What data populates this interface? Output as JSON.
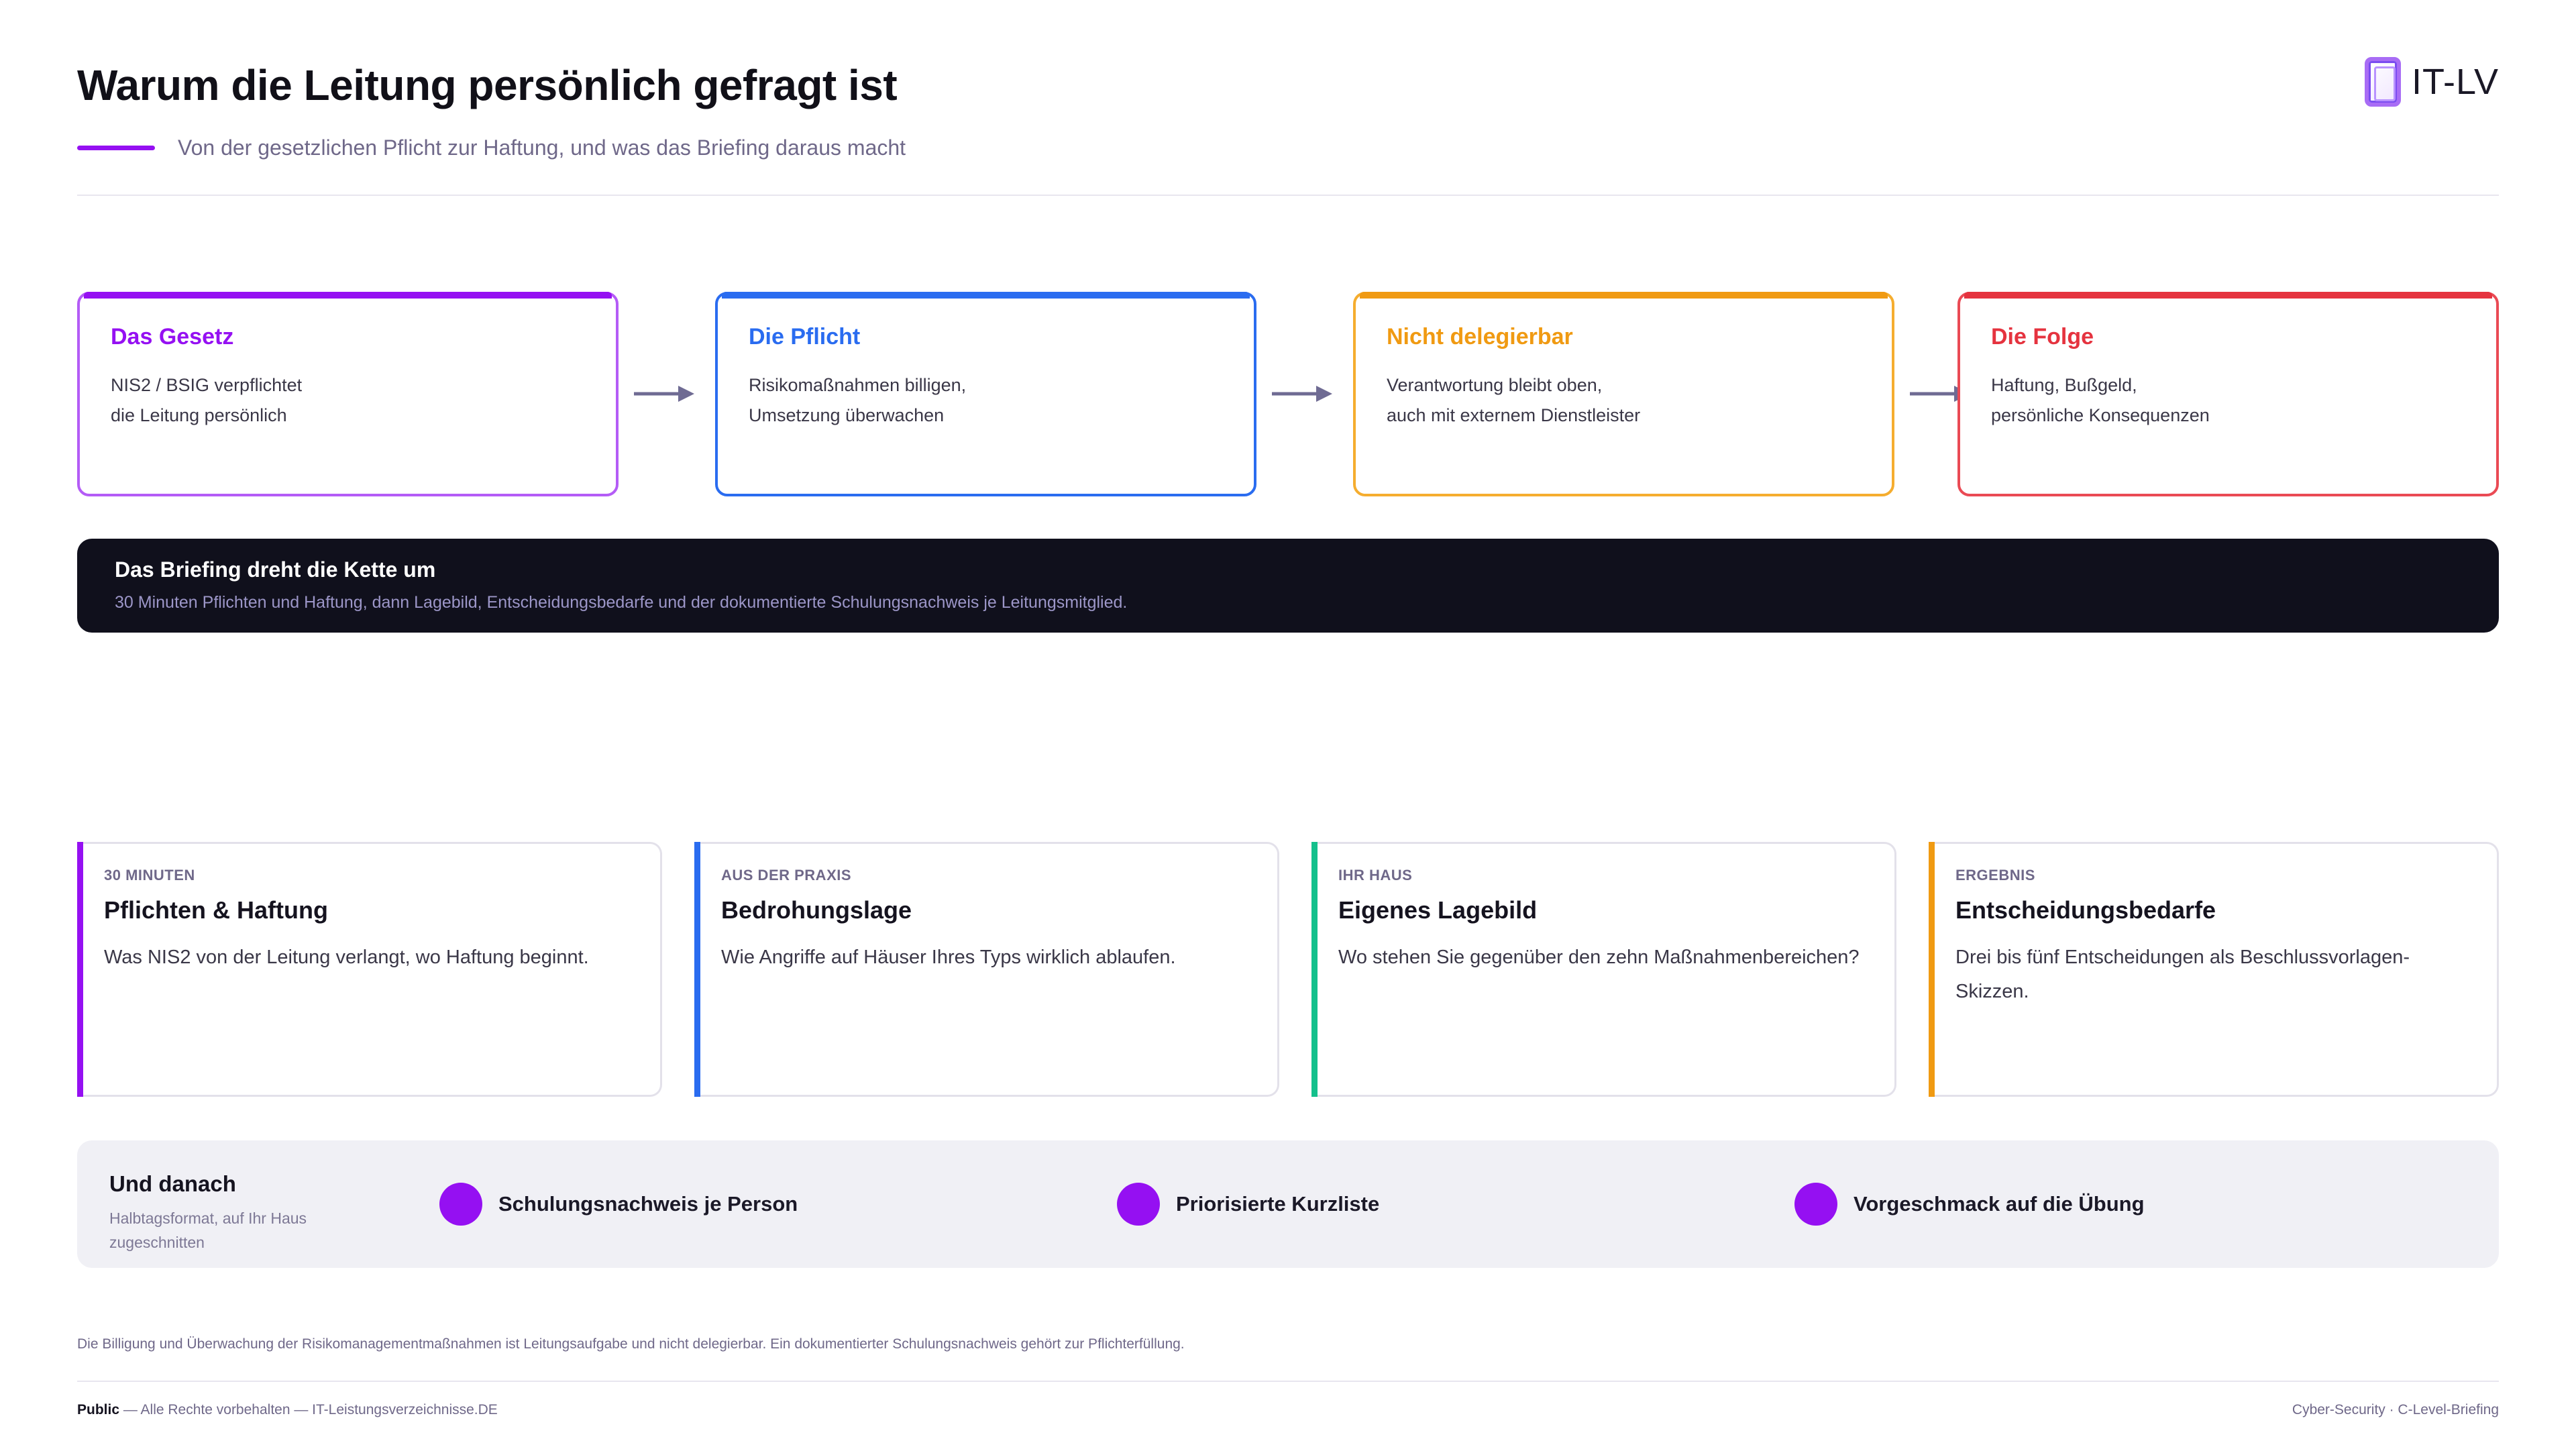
{
  "header": {
    "title": "Warum die Leitung persönlich gefragt ist",
    "subtitle": "Von der gesetzlichen Pflicht zur Haftung, und was das Briefing daraus macht",
    "logo_text": "IT-LV"
  },
  "chain": [
    {
      "title": "Das Gesetz",
      "body": "NIS2 / BSIG verpflichtet\ndie Leitung persönlich",
      "color": "#9510f2"
    },
    {
      "title": "Die Pflicht",
      "body": "Risikomaßnahmen billigen,\nUmsetzung überwachen",
      "color": "#2a6cf0"
    },
    {
      "title": "Nicht delegierbar",
      "body": "Verantwortung bleibt oben,\nauch mit externem Dienstleister",
      "color": "#f09a12"
    },
    {
      "title": "Die Folge",
      "body": "Haftung, Bußgeld,\npersönliche Konsequenzen",
      "color": "#e5333f"
    }
  ],
  "banner": {
    "title": "Das Briefing dreht die Kette um",
    "text": "30 Minuten Pflichten und Haftung, dann Lagebild, Entscheidungsbedarfe und der dokumentierte Schulungsnachweis je Leitungsmitglied."
  },
  "agenda": [
    {
      "kicker": "30 Minuten",
      "title": "Pflichten & Haftung",
      "text": "Was NIS2 von der Leitung verlangt, wo Haftung beginnt.",
      "color": "#9510f2"
    },
    {
      "kicker": "Aus der Praxis",
      "title": "Bedrohungslage",
      "text": "Wie Angriffe auf Häuser Ihres Typs wirklich ablaufen.",
      "color": "#2a6cf0"
    },
    {
      "kicker": "Ihr Haus",
      "title": "Eigenes Lagebild",
      "text": "Wo stehen Sie gegenüber den zehn Maßnahmenbereichen?",
      "color": "#14c08c"
    },
    {
      "kicker": "Ergebnis",
      "title": "Entscheidungsbedarfe",
      "text": "Drei bis fünf Entscheidungen als Beschlussvorlagen-Skizzen.",
      "color": "#f09a12"
    }
  ],
  "after": {
    "title": "Und danach",
    "subtitle": "Halbtagsformat, auf Ihr Haus zugeschnitten",
    "items": [
      "Schulungsnachweis je Person",
      "Priorisierte Kurzliste",
      "Vorgeschmack auf die Übung"
    ]
  },
  "footnote": "Die Billigung und Überwachung der Risikomanagementmaßnahmen ist Leitungsaufgabe und nicht delegierbar. Ein dokumentierter Schulungsnachweis gehört zur Pflichterfüllung.",
  "footer": {
    "classification": "Public",
    "rights": "— Alle Rechte vorbehalten — IT-Leistungsverzeichnisse.DE",
    "right": "Cyber-Security · C-Level-Briefing"
  }
}
